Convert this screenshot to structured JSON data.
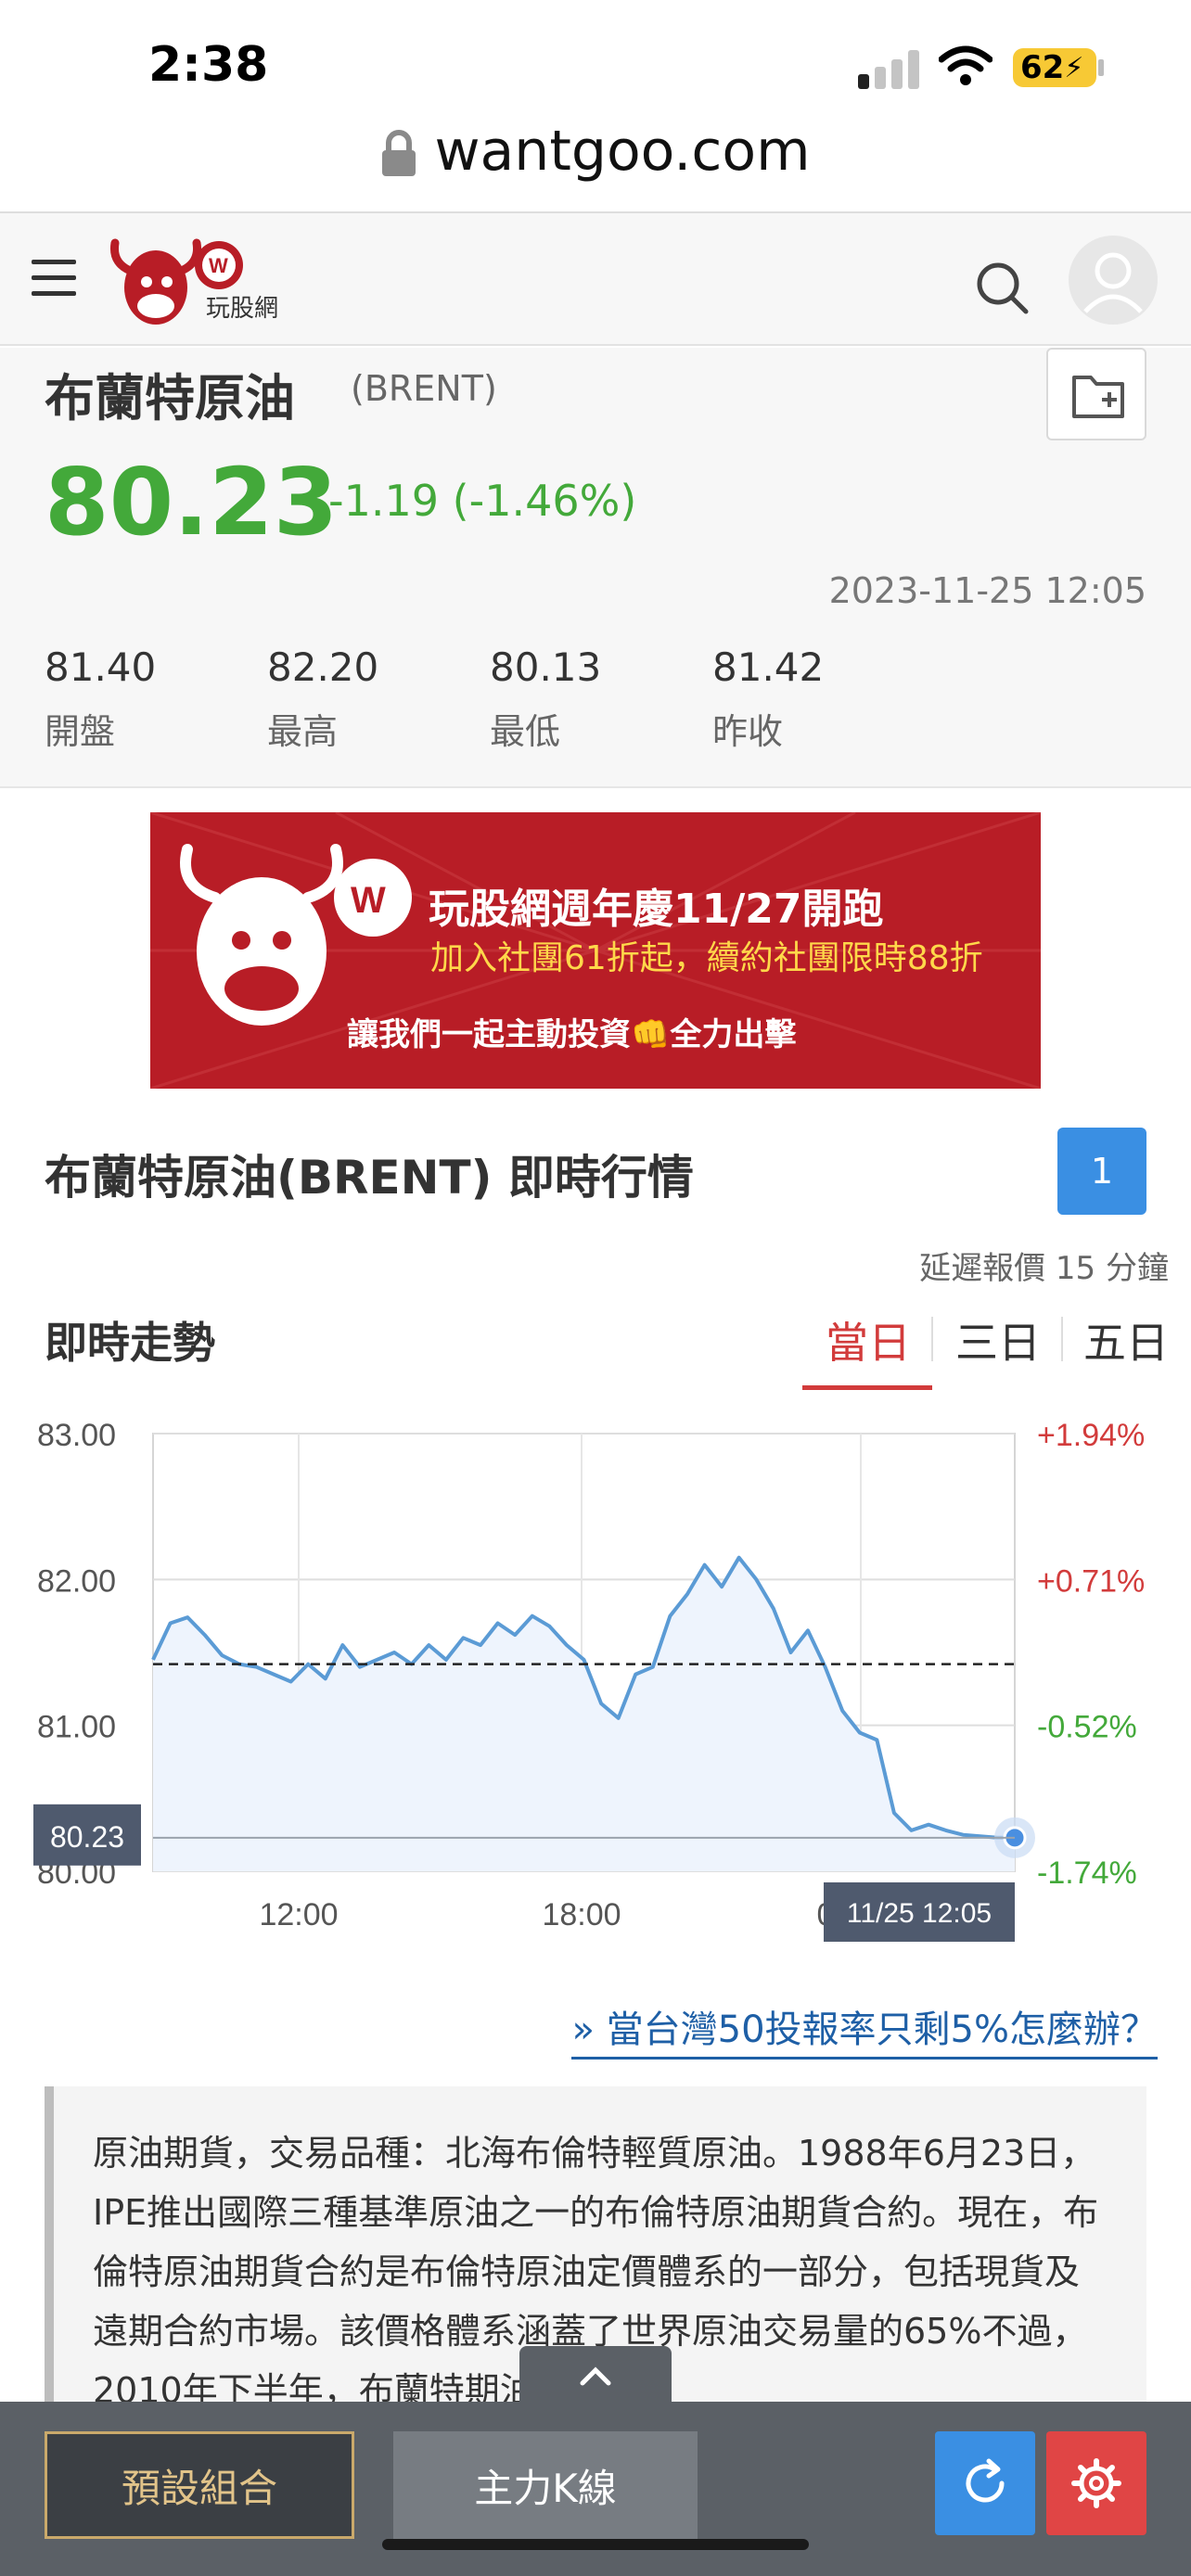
{
  "status_bar": {
    "time": "2:38",
    "battery": "62"
  },
  "browser": {
    "url": "wantgoo.com"
  },
  "header": {
    "logo_text": "玩股網"
  },
  "quote": {
    "name": "布蘭特原油",
    "code": "(BRENT)",
    "price": "80.23",
    "change": "-1.19 (-1.46%)",
    "timestamp": "2023-11-25 12:05",
    "stats": [
      {
        "value": "81.40",
        "label": "開盤"
      },
      {
        "value": "82.20",
        "label": "最高"
      },
      {
        "value": "80.13",
        "label": "最低"
      },
      {
        "value": "81.42",
        "label": "昨收"
      }
    ]
  },
  "banner": {
    "title": "玩股網週年慶11/27開跑",
    "subtitle": "加入社團61折起，續約社團限時88折",
    "tagline": "讓我們一起主動投資👊全力出擊"
  },
  "realtime": {
    "title": "布蘭特原油(BRENT) 即時行情",
    "page_label": "1",
    "delay_note": "延遲報價 15 分鐘",
    "trend_title": "即時走勢",
    "tabs": [
      "當日",
      "三日",
      "五日"
    ],
    "active_tab": "當日"
  },
  "chart_data": {
    "type": "line",
    "x_ticks": [
      "12:00",
      "18:00"
    ],
    "y_ticks": [
      83.0,
      82.0,
      81.0,
      80.0
    ],
    "y_tick_labels": [
      "83.00",
      "82.00",
      "81.00",
      "80.00"
    ],
    "pct_ticks": [
      "+1.94%",
      "+0.71%",
      "-0.52%",
      "-1.74%"
    ],
    "ylim": [
      80.0,
      83.0
    ],
    "reference_close": 81.42,
    "last_value_label": "80.23",
    "last_time_label": "11/25 12:05",
    "partial_tick_label": "0",
    "colors": {
      "line": "#5b9bd5",
      "area": "#eef4fd",
      "up": "#d23b3b",
      "down": "#43a93a"
    },
    "series": [
      {
        "x": [
          0,
          2,
          4,
          6,
          8,
          10,
          12,
          14,
          16,
          18,
          20,
          22,
          24,
          26,
          28,
          30,
          32,
          34,
          36,
          38,
          40,
          42,
          44,
          46,
          48,
          50,
          52,
          54,
          56,
          58,
          60,
          62,
          64,
          66,
          68,
          70,
          72,
          74,
          76,
          78,
          80,
          82,
          84,
          86,
          88,
          90,
          92,
          94,
          96,
          98,
          100
        ],
        "values": [
          81.45,
          81.7,
          81.74,
          81.62,
          81.48,
          81.42,
          81.4,
          81.35,
          81.3,
          81.42,
          81.32,
          81.55,
          81.4,
          81.45,
          81.5,
          81.42,
          81.55,
          81.45,
          81.6,
          81.55,
          81.7,
          81.62,
          81.75,
          81.68,
          81.55,
          81.45,
          81.15,
          81.05,
          81.35,
          81.4,
          81.75,
          81.9,
          82.1,
          81.95,
          82.15,
          82.0,
          81.8,
          81.5,
          81.65,
          81.4,
          81.1,
          80.95,
          80.9,
          80.4,
          80.28,
          80.32,
          80.28,
          80.25,
          80.24,
          80.23,
          80.23
        ]
      }
    ]
  },
  "promo_link": "» 當台灣50投報率只剩5%怎麼辦？",
  "description": "原油期貨，交易品種：北海布倫特輕質原油。1988年6月23日，IPE推出國際三種基準原油之一的布倫特原油期貨合約。現在，布倫特原油期貨合約是布倫特原油定價體系的一部分，包括現貨及遠期合約市場。該價格體系涵蓋了世界原油交易量的65%不過，2010年下半年，布蘭特期油",
  "bottom_bar": {
    "preset_label": "預設組合",
    "kline_label": "主力K線"
  }
}
